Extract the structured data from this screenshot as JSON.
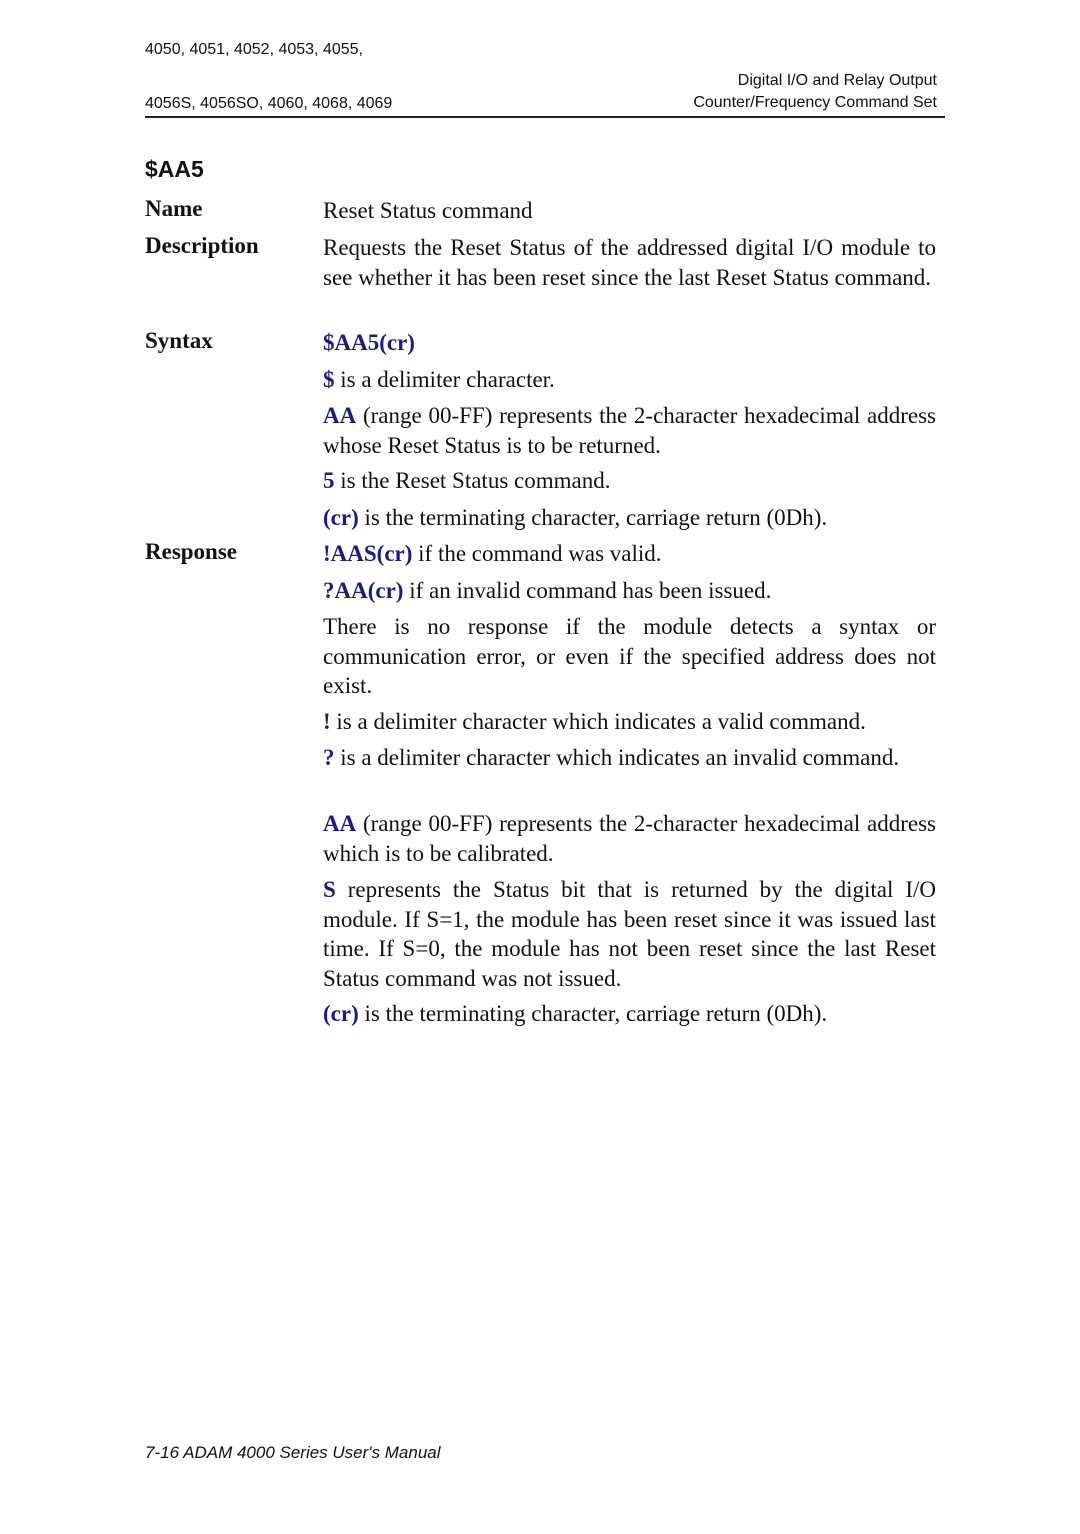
{
  "header": {
    "left_line1": "4050, 4051, 4052, 4053, 4055,",
    "left_line2": "4056S, 4056SO, 4060, 4068, 4069",
    "right_line1": "Digital I/O and Relay Output",
    "right_line2": "Counter/Frequency Command Set"
  },
  "command_title": "$AA5",
  "labels": {
    "name": "Name",
    "description": "Description",
    "syntax": "Syntax",
    "response": "Response"
  },
  "name_text": "Reset Status command",
  "description_text": "Requests the Reset Status of the addressed digital I/O module to see whether it has been reset since the last Reset Status command.",
  "syntax": {
    "command": "$AA5(cr)",
    "items": [
      {
        "kw": "$",
        "text": " is a delimiter character."
      },
      {
        "kw": "AA",
        "text": " (range 00-FF) represents the 2-character hexadecimal address whose Reset Status is to be returned."
      },
      {
        "kw": "5",
        "text": " is the Reset Status command."
      },
      {
        "kw": "(cr)",
        "text": " is the terminating character, carriage return (0Dh)."
      }
    ]
  },
  "response": {
    "items": [
      {
        "kw": "!AAS(cr)",
        "text": " if the command was valid."
      },
      {
        "kw": "?AA(cr)",
        "text": " if an invalid command has been issued."
      },
      {
        "kw": "",
        "text": "There is no response if the module detects a syntax or communication error, or even if the specified address does not exist."
      },
      {
        "kw": "!",
        "text": " is a delimiter character which indicates a valid command."
      },
      {
        "kw": "?",
        "text": " is a delimiter character which indicates an invalid command."
      },
      {
        "kw": "AA",
        "text": " (range 00-FF) represents the 2-character hexadecimal address which is to be calibrated."
      },
      {
        "kw": "S",
        "text": " represents the Status bit that is returned by the digital I/O module. If S=1, the module has been reset since it was issued last time. If S=0, the module has not been reset since the last Reset Status command was not issued."
      },
      {
        "kw": "(cr)",
        "text": " is the terminating character, carriage return (0Dh)."
      }
    ]
  },
  "footer": "7-16 ADAM 4000 Series User's Manual",
  "colors": {
    "keyword": "#1a1a8c",
    "text": "#111111"
  }
}
